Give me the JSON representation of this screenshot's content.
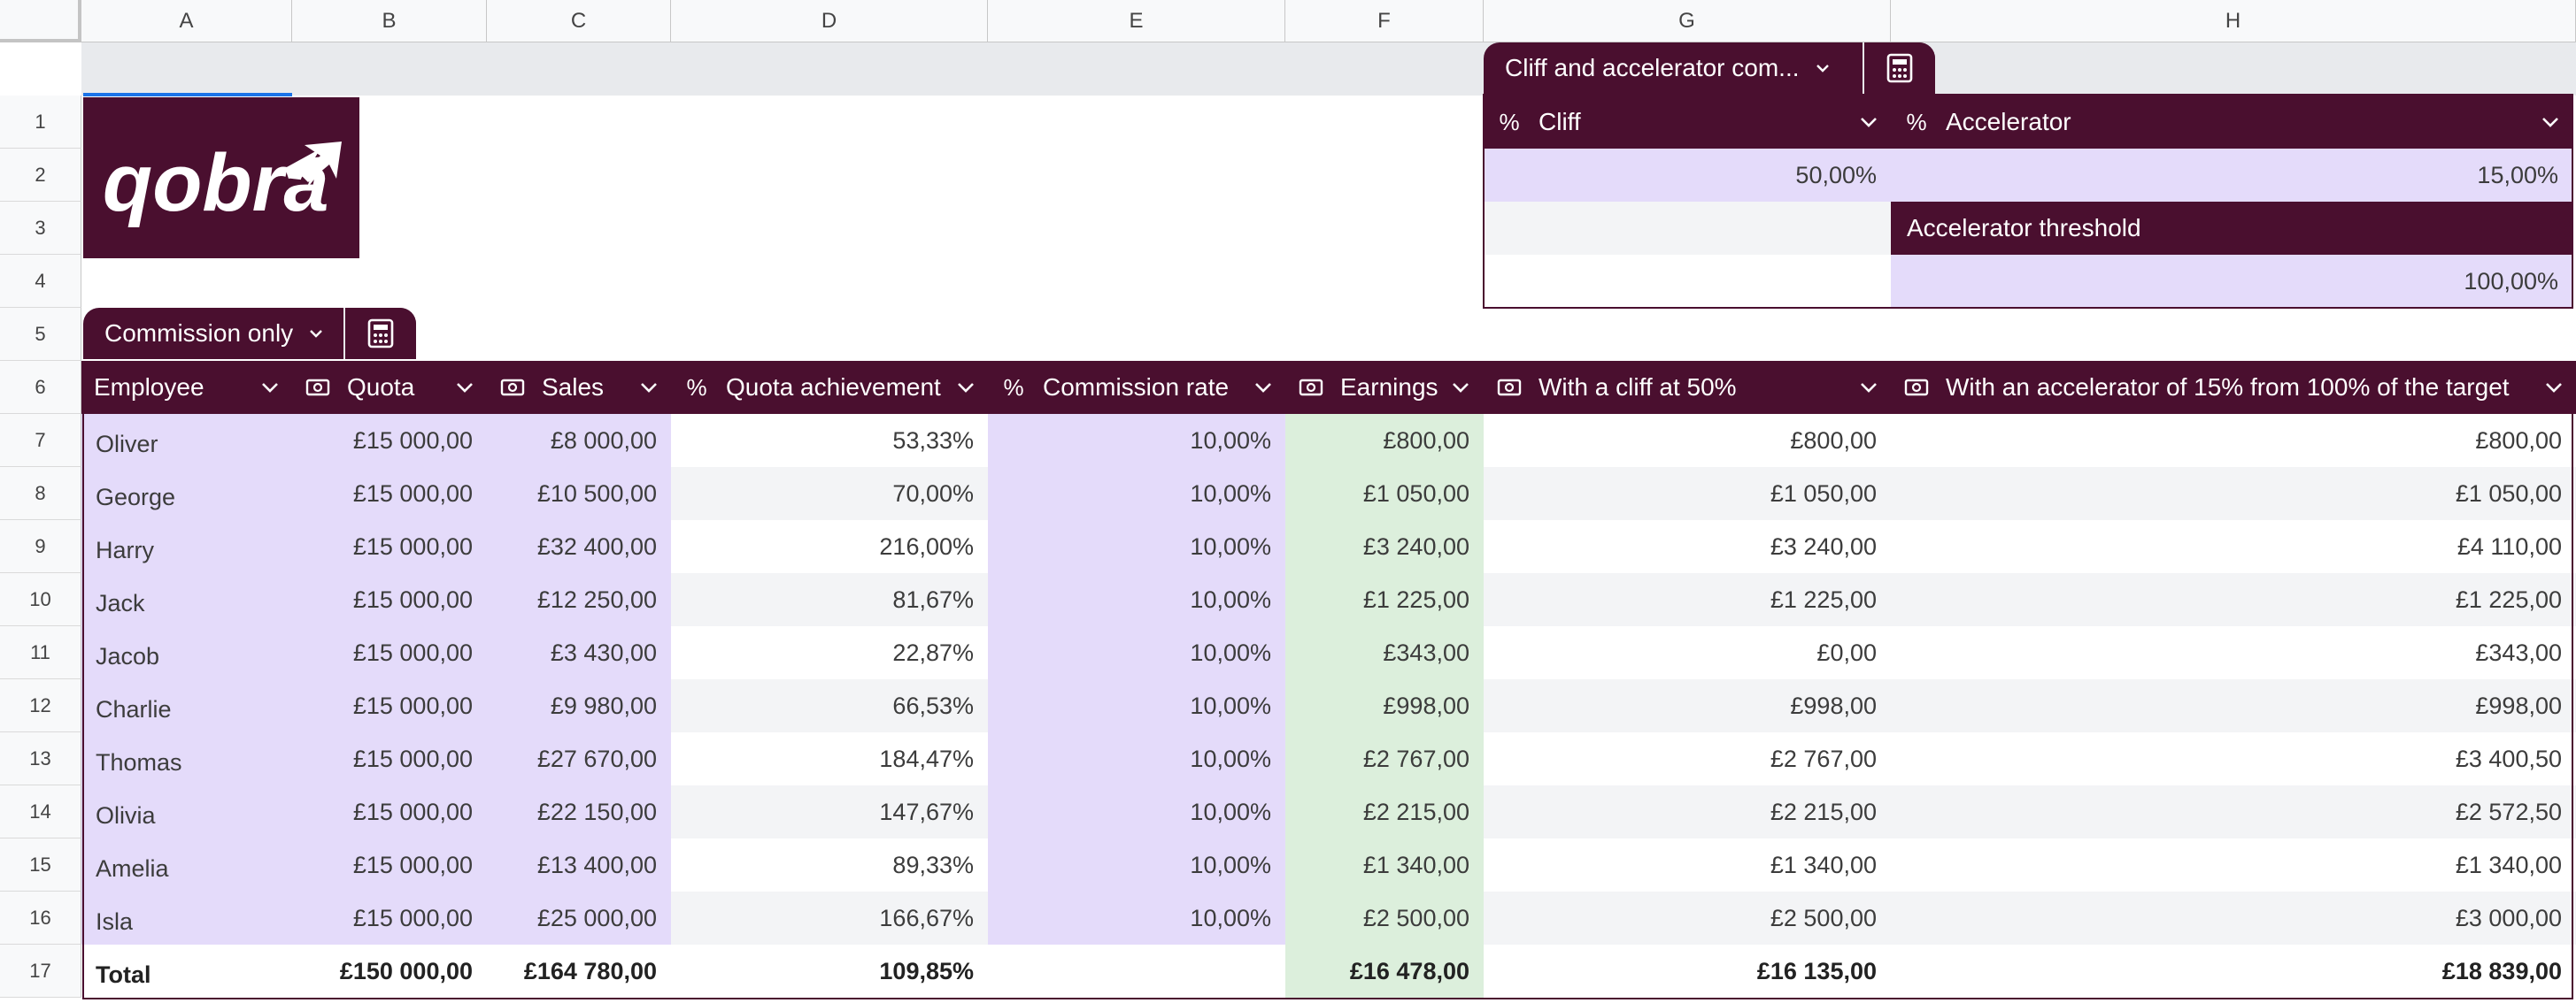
{
  "columns": [
    "A",
    "B",
    "C",
    "D",
    "E",
    "F",
    "G",
    "H"
  ],
  "rows": [
    "1",
    "2",
    "3",
    "4",
    "5",
    "6",
    "7",
    "8",
    "9",
    "10",
    "11",
    "12",
    "13",
    "14",
    "15",
    "16",
    "17"
  ],
  "cliff_table": {
    "tab_title": "Cliff and accelerator com...",
    "cliff_header": "Cliff",
    "accelerator_header": "Accelerator",
    "cliff_value": "50,00%",
    "accelerator_value": "15,00%",
    "threshold_label": "Accelerator threshold",
    "threshold_value": "100,00%"
  },
  "main_table": {
    "tab_title": "Commission only",
    "headers": {
      "employee": "Employee",
      "quota": "Quota",
      "sales": "Sales",
      "quota_achievement": "Quota achievement",
      "commission_rate": "Commission rate",
      "earnings": "Earnings",
      "cliff": "With a cliff at 50%",
      "accelerator": "With an accelerator of 15% from 100% of the target"
    },
    "rows": [
      {
        "employee": "Oliver",
        "quota": "£15 000,00",
        "sales": "£8 000,00",
        "achievement": "53,33%",
        "rate": "10,00%",
        "earnings": "£800,00",
        "cliff": "£800,00",
        "accel": "£800,00"
      },
      {
        "employee": "George",
        "quota": "£15 000,00",
        "sales": "£10 500,00",
        "achievement": "70,00%",
        "rate": "10,00%",
        "earnings": "£1 050,00",
        "cliff": "£1 050,00",
        "accel": "£1 050,00"
      },
      {
        "employee": "Harry",
        "quota": "£15 000,00",
        "sales": "£32 400,00",
        "achievement": "216,00%",
        "rate": "10,00%",
        "earnings": "£3 240,00",
        "cliff": "£3 240,00",
        "accel": "£4 110,00"
      },
      {
        "employee": "Jack",
        "quota": "£15 000,00",
        "sales": "£12 250,00",
        "achievement": "81,67%",
        "rate": "10,00%",
        "earnings": "£1 225,00",
        "cliff": "£1 225,00",
        "accel": "£1 225,00"
      },
      {
        "employee": "Jacob",
        "quota": "£15 000,00",
        "sales": "£3 430,00",
        "achievement": "22,87%",
        "rate": "10,00%",
        "earnings": "£343,00",
        "cliff": "£0,00",
        "accel": "£343,00"
      },
      {
        "employee": "Charlie",
        "quota": "£15 000,00",
        "sales": "£9 980,00",
        "achievement": "66,53%",
        "rate": "10,00%",
        "earnings": "£998,00",
        "cliff": "£998,00",
        "accel": "£998,00"
      },
      {
        "employee": "Thomas",
        "quota": "£15 000,00",
        "sales": "£27 670,00",
        "achievement": "184,47%",
        "rate": "10,00%",
        "earnings": "£2 767,00",
        "cliff": "£2 767,00",
        "accel": "£3 400,50"
      },
      {
        "employee": "Olivia",
        "quota": "£15 000,00",
        "sales": "£22 150,00",
        "achievement": "147,67%",
        "rate": "10,00%",
        "earnings": "£2 215,00",
        "cliff": "£2 215,00",
        "accel": "£2 572,50"
      },
      {
        "employee": "Amelia",
        "quota": "£15 000,00",
        "sales": "£13 400,00",
        "achievement": "89,33%",
        "rate": "10,00%",
        "earnings": "£1 340,00",
        "cliff": "£1 340,00",
        "accel": "£1 340,00"
      },
      {
        "employee": "Isla",
        "quota": "£15 000,00",
        "sales": "£25 000,00",
        "achievement": "166,67%",
        "rate": "10,00%",
        "earnings": "£2 500,00",
        "cliff": "£2 500,00",
        "accel": "£3 000,00"
      }
    ],
    "total": {
      "employee": "Total",
      "quota": "£150 000,00",
      "sales": "£164 780,00",
      "achievement": "109,85%",
      "rate": "",
      "earnings": "£16 478,00",
      "cliff": "£16 135,00",
      "accel": "£18 839,00"
    }
  },
  "colors": {
    "brand": "#4a0f2f",
    "lavender": "#e4dbfa",
    "green": "#dcefdc",
    "banded": "#f3f4f6"
  },
  "icons": {
    "percent": "percent-icon",
    "money": "money-icon",
    "dropdown": "chevron-down-icon",
    "calculator": "calculator-icon"
  }
}
